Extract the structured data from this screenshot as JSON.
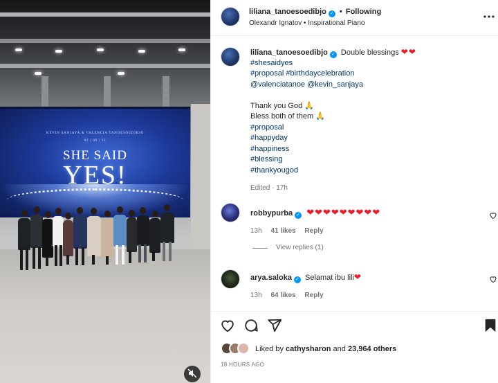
{
  "post": {
    "username": "liliana_tanoesoedibjo",
    "follow_status": "Following",
    "audio": "Olexandr Ignatov • Inspirational Piano",
    "banner": {
      "names": "KEVIN SANJAYA  &  VALENCIA TANOESOEDIBJO",
      "date": "02 | 09 | 22",
      "headline": "SHE SAID",
      "big": "YES!"
    }
  },
  "caption": {
    "username": "liliana_tanoesoedibjo",
    "first_line_text": "Double blessings",
    "first_line_hearts": "❤❤",
    "lines": [
      "#shesaidyes",
      "#proposal #birthdaycelebration",
      "@valenciatanoe @kevin_sanjaya",
      "",
      "Thank you God 🙏",
      "Bless both of them 🙏",
      "#proposal",
      "#happyday",
      "#happiness",
      "#blessing",
      "#thankyougod"
    ],
    "edited": "Edited · 17h"
  },
  "comments": [
    {
      "username": "robbypurba",
      "text": "❤❤❤❤❤❤❤❤❤",
      "time": "13h",
      "likes": "41 likes",
      "reply": "Reply",
      "view_replies": "View replies (1)"
    },
    {
      "username": "arya.saloka",
      "text": "Selamat ibu lili",
      "heart": "❤",
      "time": "13h",
      "likes": "64 likes",
      "reply": "Reply"
    }
  ],
  "likes": {
    "prefix": "Liked by",
    "user": "cathysharon",
    "and": "and",
    "others": "23,964 others"
  },
  "timestamp": "18 HOURS AGO",
  "icons": [
    "more-icon",
    "heart-icon",
    "comment-icon",
    "share-icon",
    "bookmark-icon",
    "mute-icon",
    "verified-icon"
  ],
  "colors": {
    "link": "#00376b",
    "verified": "#0095f6",
    "heart": "#ed1c24",
    "muted": "#737373"
  }
}
